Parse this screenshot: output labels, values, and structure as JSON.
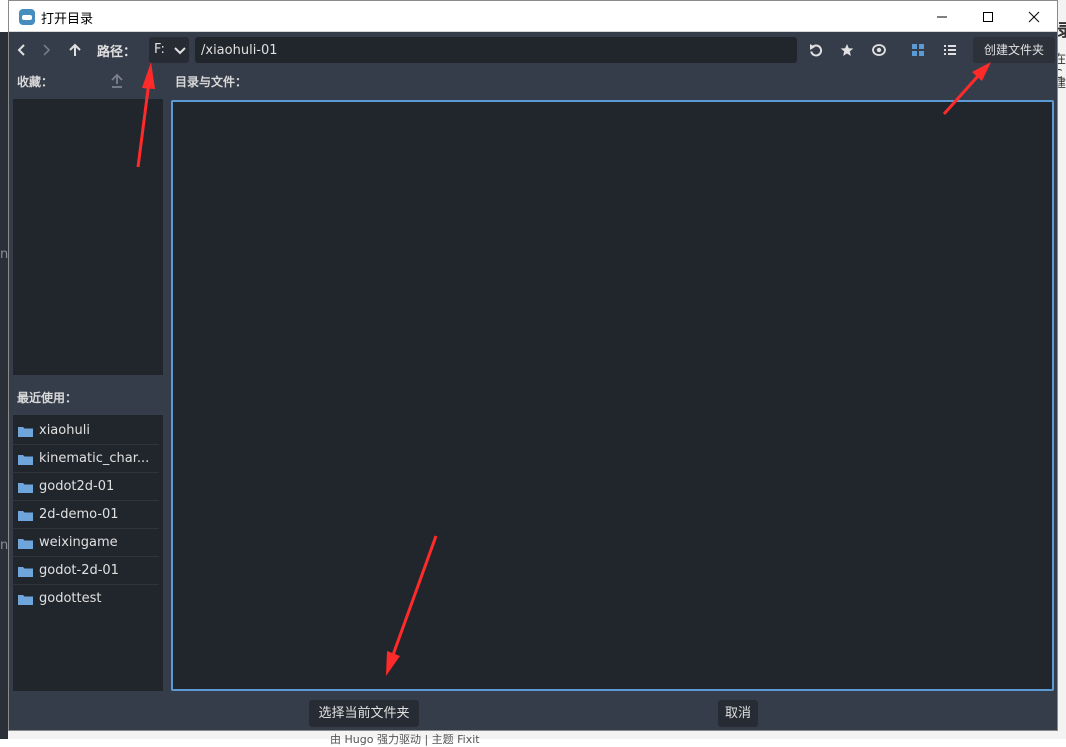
{
  "window": {
    "title": "打开目录"
  },
  "toolbar": {
    "path_label": "路径：",
    "drive": "F:",
    "path": "/xiaohuli-01",
    "create_folder_label": "创建文件夹"
  },
  "favorites": {
    "header": "收藏："
  },
  "recent": {
    "header": "最近使用：",
    "items": [
      {
        "label": "xiaohuli"
      },
      {
        "label": "kinematic_char..."
      },
      {
        "label": "godot2d-01"
      },
      {
        "label": "2d-demo-01"
      },
      {
        "label": "weixingame"
      },
      {
        "label": "godot-2d-01"
      },
      {
        "label": "godottest"
      }
    ]
  },
  "files": {
    "header": "目录与文件："
  },
  "footer": {
    "select_label": "选择当前文件夹",
    "cancel_label": "取消"
  },
  "background": {
    "fragment_1": "录",
    "fragment_2": "在C",
    "fragment_3": "建",
    "fragment_4": "n",
    "fragment_5": "n",
    "bottom_text": "由 Hugo 强力驱动 | 主题   Fixit"
  },
  "colors": {
    "window_bg": "#363d4a",
    "panel_bg": "#21252c",
    "accent": "#5c9ad6",
    "folder": "#6ea6dc",
    "annotation_arrow": "#ff2a2a"
  }
}
